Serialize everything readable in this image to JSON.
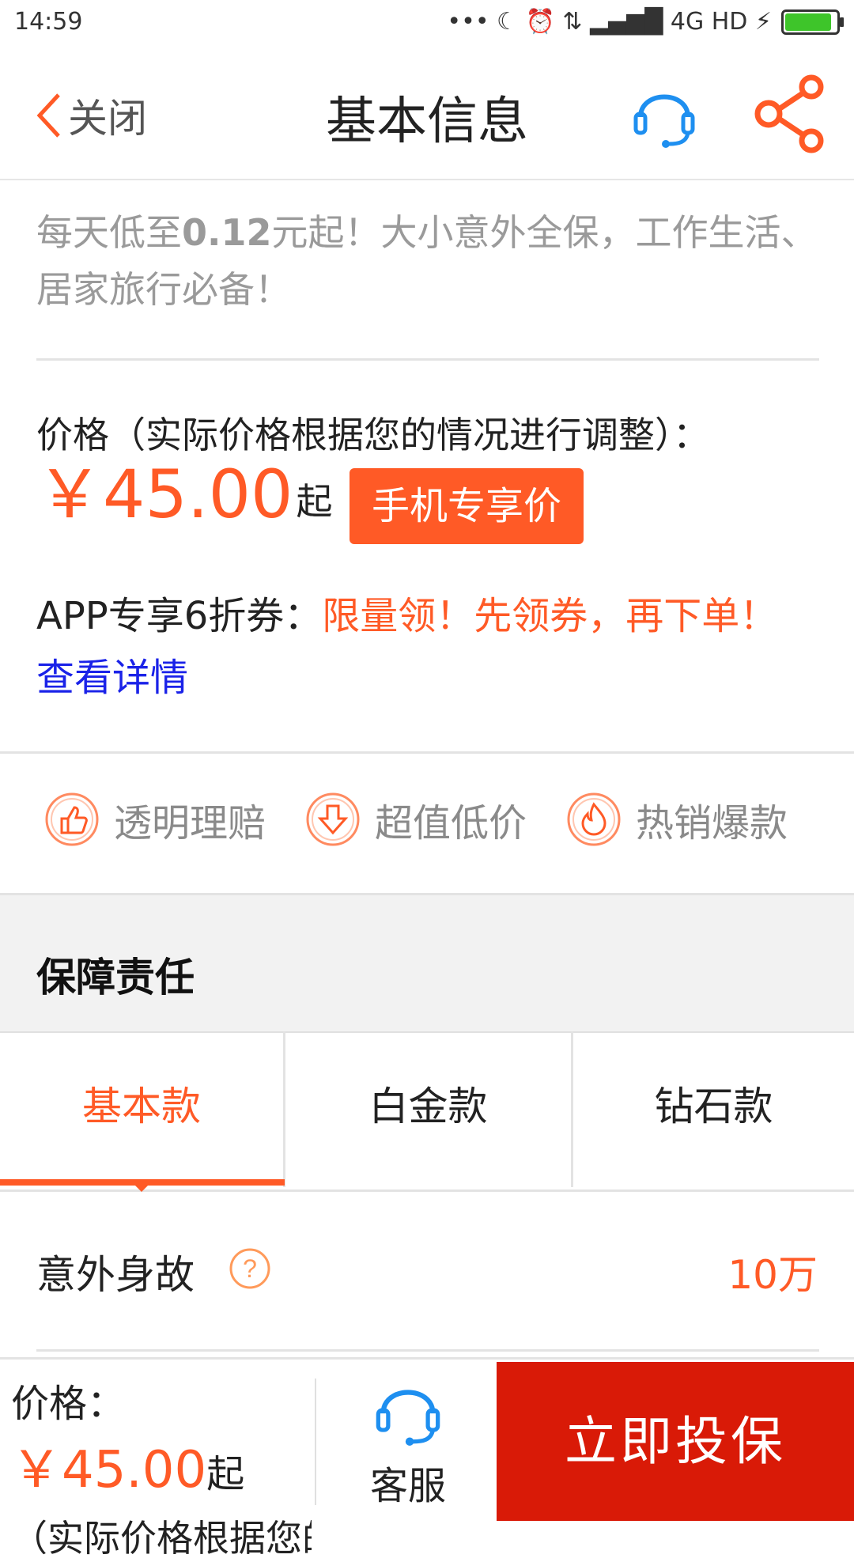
{
  "status_bar": {
    "time": "14:59",
    "indicators": "••• ☾ ⏰ ⇅ ▂▄▆█ 4G HD ⚡",
    "battery_level": 1.0
  },
  "header": {
    "back_label": "关闭",
    "title": "基本信息",
    "service_icon": "headset-icon",
    "share_icon": "share-icon"
  },
  "promo": {
    "prefix": "每天低至",
    "highlight": "0.12",
    "suffix": "元起！大小意外全保，工作生活、居家旅行必备！"
  },
  "price": {
    "label": "价格（实际价格根据您的情况进行调整）：",
    "value": "￥45.00",
    "suffix": "起",
    "badge": "手机专享价"
  },
  "coupon": {
    "label": "APP专享6折券：",
    "highlight": "限量领！先领券，再下单！",
    "link": "查看详情"
  },
  "features": [
    {
      "label": "透明理赔",
      "icon": "thumbs-up-icon"
    },
    {
      "label": "超值低价",
      "icon": "down-arrow-icon"
    },
    {
      "label": "热销爆款",
      "icon": "flame-icon"
    }
  ],
  "coverage": {
    "title": "保障责任",
    "tabs": [
      "基本款",
      "白金款",
      "钻石款"
    ],
    "active_tab": 0,
    "rows": [
      {
        "name": "意外身故",
        "amount": "10万",
        "help_icon": "question-icon"
      }
    ]
  },
  "bottom_bar": {
    "price_label": "价格：",
    "price_value": "￥45.00",
    "price_suffix": "起",
    "note": "（实际价格根据您的",
    "service_label": "客服",
    "buy_label": "立即投保"
  },
  "colors": {
    "accent": "#ff5a26",
    "buy_button": "#d91a07",
    "link": "#1a22e8",
    "service_icon": "#1e8ff0"
  }
}
